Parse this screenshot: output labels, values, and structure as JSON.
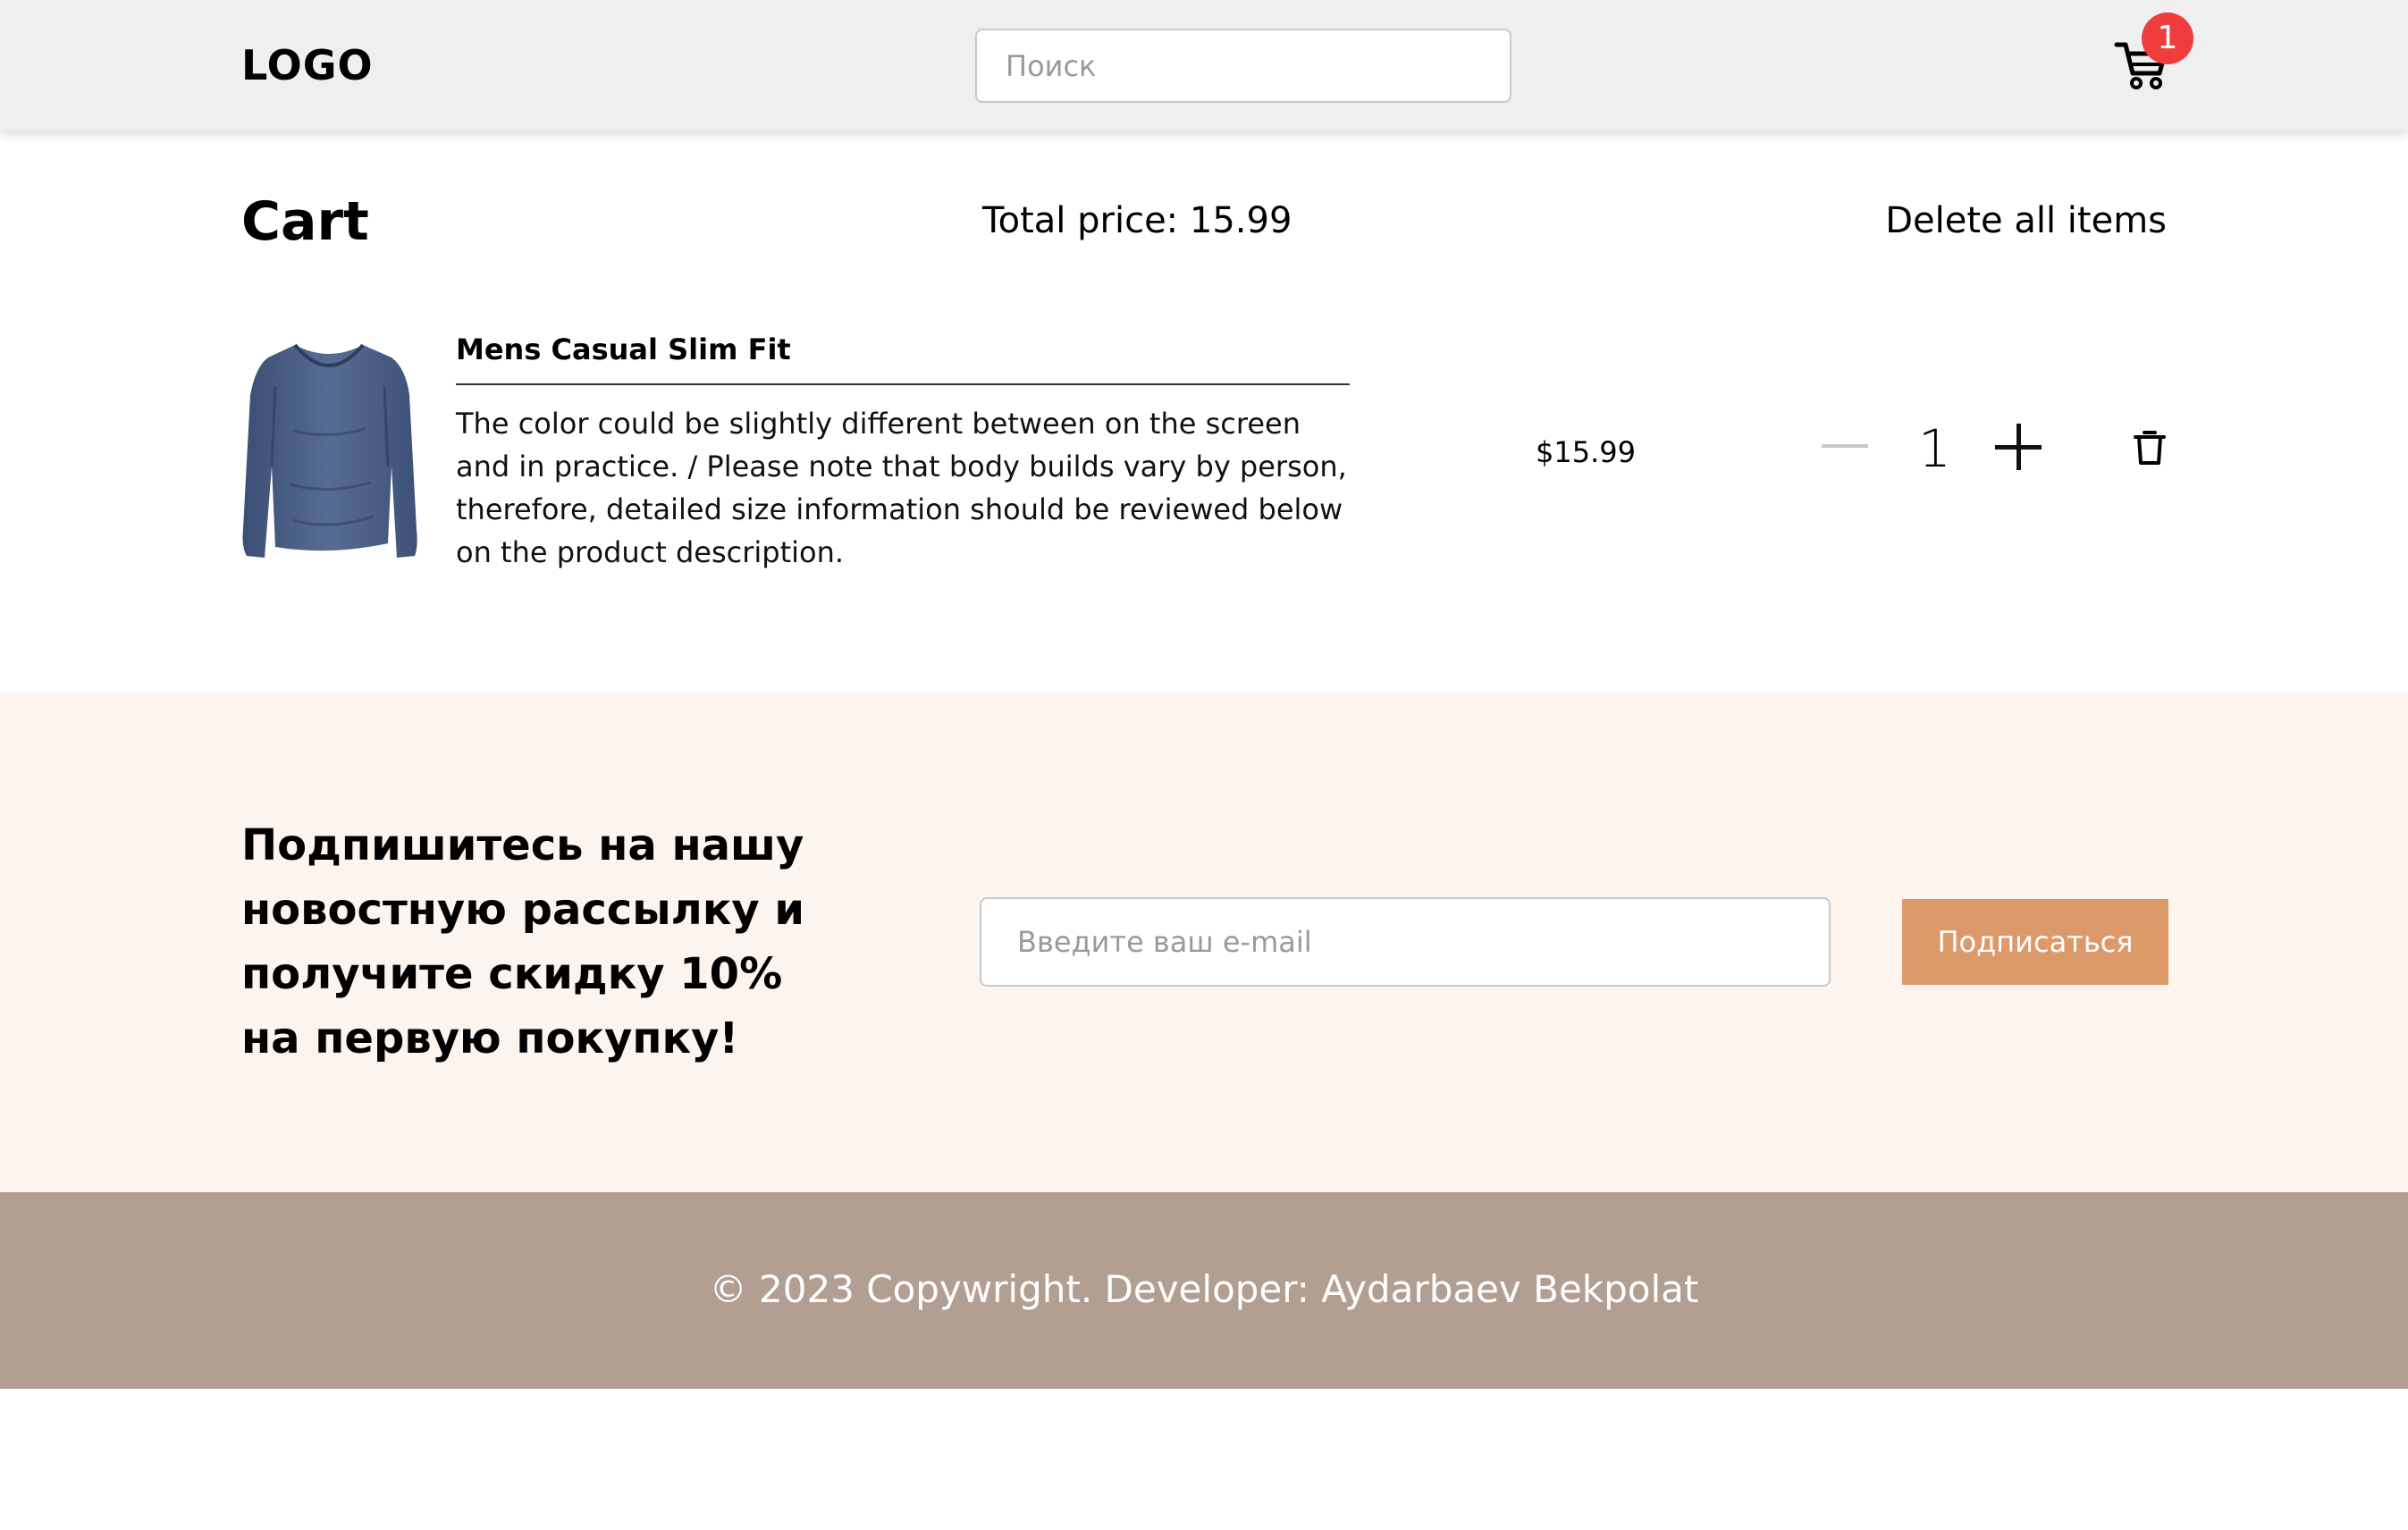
{
  "header": {
    "logo": "LOGO",
    "search_placeholder": "Поиск",
    "cart_count": "1"
  },
  "cart": {
    "title": "Cart",
    "total_price": "Total price: 15.99",
    "delete_all": "Delete all items"
  },
  "items": [
    {
      "name": "Mens Casual Slim Fit",
      "description": "The color could be slightly different between on the screen and in practice. / Please note that body builds vary by person, therefore, detailed size information should be reviewed below on the product description.",
      "price": "$15.99",
      "quantity": "1",
      "image": "blue-long-sleeve-shirt"
    }
  ],
  "subscribe": {
    "heading": "Подпишитесь на нашу новостную рассылку и получите скидку 10% на первую покупку!",
    "email_placeholder": "Введите ваш e-mail",
    "button": "Подписаться",
    "button_color": "#dc9a6b"
  },
  "footer": {
    "text": "© 2023 Copywright. Developer: Aydarbaev Bekpolat",
    "color": "#b29f92"
  },
  "icons": {
    "cart": "cart-icon",
    "minus": "minus-icon",
    "plus": "plus-icon",
    "trash": "trash-icon"
  }
}
